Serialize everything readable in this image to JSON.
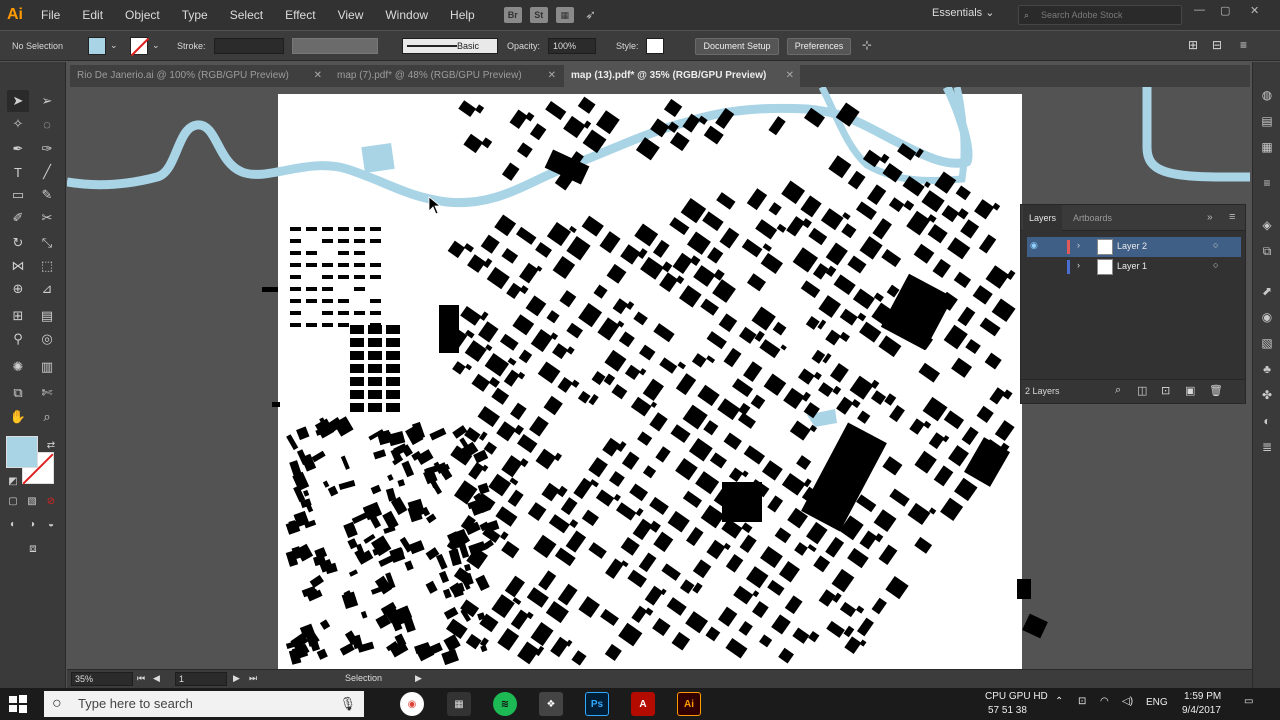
{
  "app": {
    "logo": "Ai",
    "menu": [
      "File",
      "Edit",
      "Object",
      "Type",
      "Select",
      "Effect",
      "View",
      "Window",
      "Help"
    ],
    "menu_icons": [
      "Br",
      "St"
    ],
    "workspace": "Essentials",
    "stock_search_placeholder": "Search Adobe Stock"
  },
  "control": {
    "selection": "No Selection",
    "stroke_label": "Stroke:",
    "brush": "Basic",
    "opacity_label": "Opacity:",
    "opacity_value": "100%",
    "style_label": "Style:",
    "doc_setup": "Document Setup",
    "preferences": "Preferences"
  },
  "tabs": [
    {
      "label": "Rio De Janerio.ai @ 100% (RGB/GPU Preview)",
      "active": false
    },
    {
      "label": "map (7).pdf* @ 48% (RGB/GPU Preview)",
      "active": false
    },
    {
      "label": "map (13).pdf* @ 35% (RGB/GPU Preview)",
      "active": true
    }
  ],
  "layers": {
    "tabs": [
      "Layers",
      "Artboards"
    ],
    "items": [
      {
        "name": "Layer 2",
        "color": "#e05a5a",
        "selected": true
      },
      {
        "name": "Layer 1",
        "color": "#4a6fd0",
        "selected": false
      }
    ],
    "count": "2 Layers"
  },
  "status": {
    "zoom": "35%",
    "artboard": "1",
    "tool": "Selection"
  },
  "taskbar": {
    "search_placeholder": "Type here to search",
    "apps": [
      "Chrome",
      "Calculator",
      "Spotify",
      "Photoshop",
      "Acrobat",
      "Illustrator"
    ],
    "cpu_label": "CPU GPU HD",
    "cpu_values": "57  51  38",
    "lang": "ENG",
    "time": "1:59 PM",
    "date": "9/4/2017"
  },
  "colors": {
    "accent_fill": "#a8d4e6",
    "river": "#a8d4e6",
    "illustrator_orange": "#ff9a00"
  }
}
